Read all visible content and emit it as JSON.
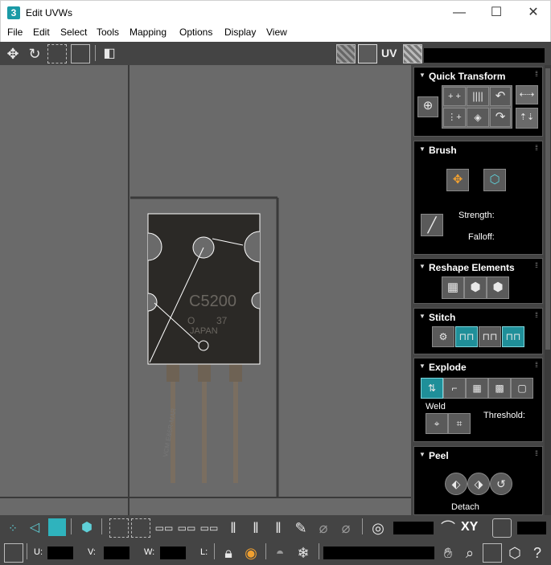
{
  "window": {
    "title": "Edit UVWs",
    "app_icon_text": "3",
    "minimize": "—",
    "maximize": "☐",
    "close": "✕"
  },
  "menu": [
    "File",
    "Edit",
    "Select",
    "Tools",
    "Mapping",
    "Options",
    "Display",
    "View"
  ],
  "toolbar": {
    "uv_label": "UV"
  },
  "texture": {
    "part_text": "C5200",
    "part_text_small": "O",
    "part_num": "37",
    "country": "JAPAN",
    "watermark": "VCM E&6R-MAR"
  },
  "panel": {
    "quick_transform": "Quick Transform",
    "brush": "Brush",
    "strength_label": "Strength:",
    "falloff_label": "Falloff:",
    "reshape": "Reshape Elements",
    "stitch": "Stitch",
    "explode": "Explode",
    "weld_label": "Weld",
    "threshold_label": "Threshold:",
    "peel": "Peel",
    "detach_label": "Detach"
  },
  "bottom": {
    "xy_label": "XY",
    "u_label": "U:",
    "v_label": "V:",
    "w_label": "W:",
    "l_label": "L:"
  },
  "colors": {
    "accent_teal": "#1f8f99",
    "toolbar_bg": "#444444",
    "viewport_bg": "#6a6a6a"
  }
}
